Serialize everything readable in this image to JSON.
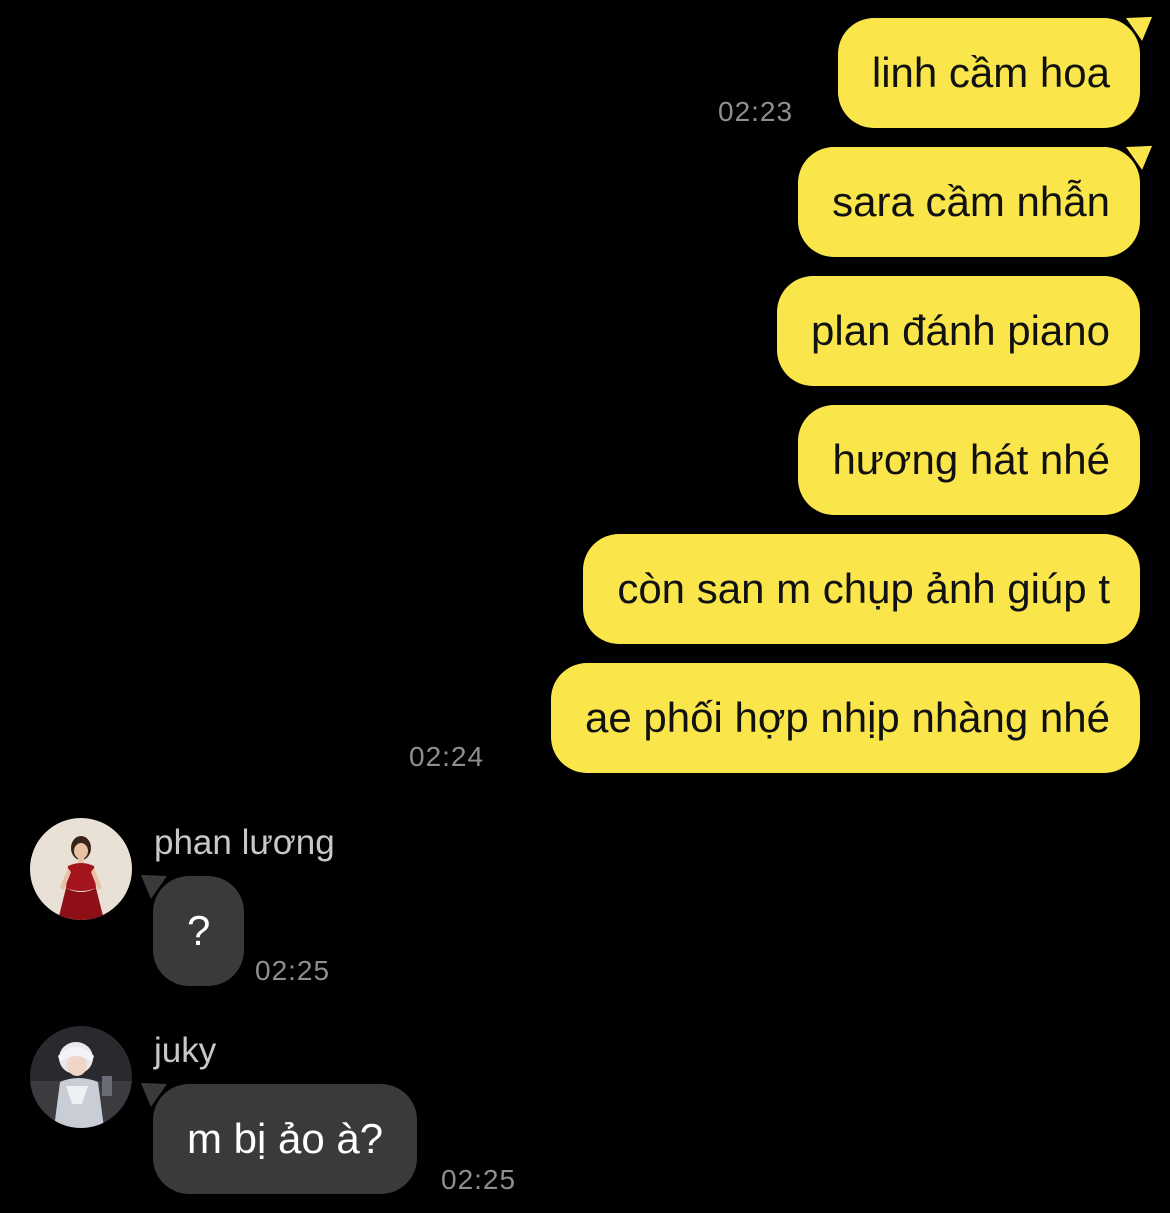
{
  "outgoing": [
    {
      "text": "linh cầm hoa"
    },
    {
      "text": "sara cầm nhẫn"
    },
    {
      "text": "plan đánh piano"
    },
    {
      "text": "hương hát nhé"
    },
    {
      "text": "còn san m chụp ảnh giúp t"
    },
    {
      "text": "ae phối hợp nhịp nhàng nhé"
    }
  ],
  "outgoing_times": [
    "02:23",
    "02:24"
  ],
  "incoming": [
    {
      "sender": "phan lương",
      "text": "?",
      "time": "02:25",
      "avatar_icon": "avatar-red-dress"
    },
    {
      "sender": "juky",
      "text": "m bị ảo à?",
      "time": "02:25",
      "avatar_icon": "avatar-silver-hair"
    }
  ],
  "colors": {
    "background": "#000000",
    "outgoing_bubble": "#fae64b",
    "incoming_bubble": "#3a3a3c",
    "timestamp": "#8e8e8e"
  }
}
